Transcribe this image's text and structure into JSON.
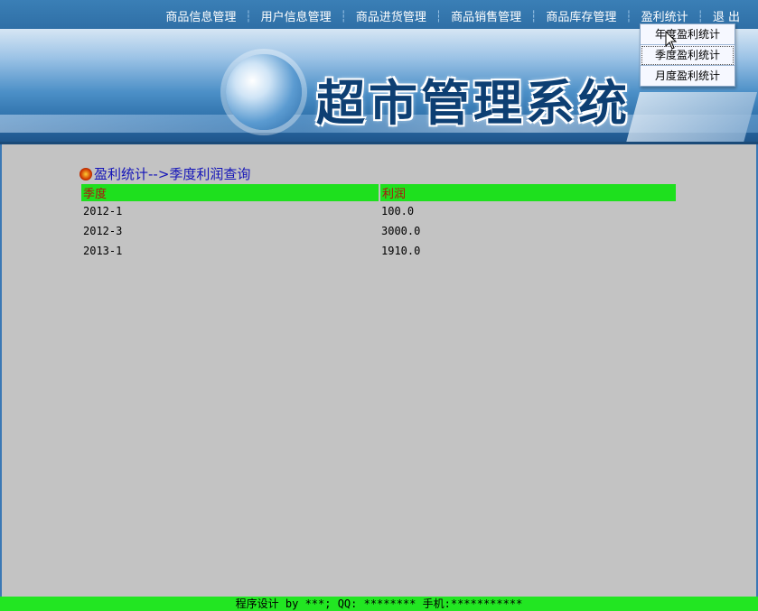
{
  "nav": {
    "items": [
      "商品信息管理",
      "用户信息管理",
      "商品进货管理",
      "商品销售管理",
      "商品库存管理",
      "盈利统计",
      "退 出"
    ]
  },
  "dropdown": {
    "options": [
      "年度盈利统计",
      "季度盈利统计",
      "月度盈利统计"
    ]
  },
  "banner": {
    "title": "超市管理系统"
  },
  "breadcrumb": "盈利统计-->季度利润查询",
  "table": {
    "headers": [
      "季度",
      "利润"
    ],
    "rows": [
      [
        "2012-1",
        "100.0"
      ],
      [
        "2012-3",
        "3000.0"
      ],
      [
        "2013-1",
        "1910.0"
      ]
    ]
  },
  "footer": "程序设计 by ***; QQ: ******** 手机:***********",
  "colors": {
    "header_bg": "#1ee01e",
    "header_text": "#b01010",
    "page_bg": "#c3c3c3",
    "footer_bg": "#22e622"
  }
}
